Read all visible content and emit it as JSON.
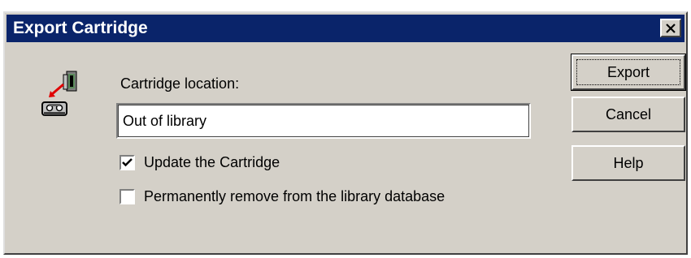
{
  "window": {
    "title": "Export Cartridge",
    "close_icon": "close-icon"
  },
  "form": {
    "location_label": "Cartridge location:",
    "location_value": "Out of library",
    "update_label": "Update the Cartridge",
    "update_checked": true,
    "remove_label": "Permanently remove from the library database",
    "remove_checked": false
  },
  "buttons": {
    "export": "Export",
    "cancel": "Cancel",
    "help": "Help"
  },
  "icons": {
    "export_icon": "export-cartridge-icon"
  },
  "colors": {
    "titlebar": "#0a246a",
    "dialog_bg": "#d4d0c8"
  }
}
